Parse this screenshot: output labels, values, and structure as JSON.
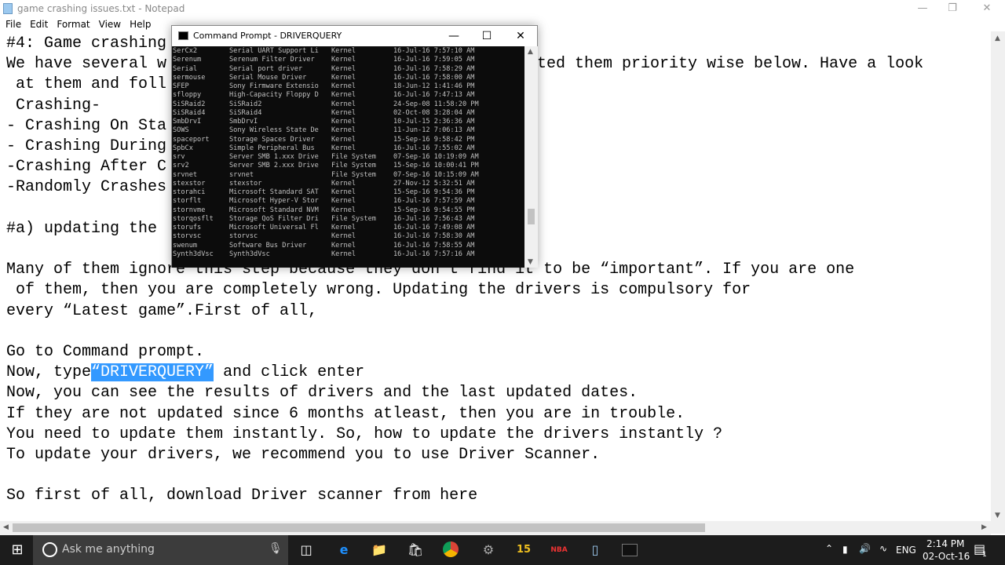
{
  "notepad": {
    "title": "game crashing issues.txt - Notepad",
    "menu": [
      "File",
      "Edit",
      "Format",
      "View",
      "Help"
    ],
    "lines": [
      {
        "left": "#4: Game crashing",
        "right": ""
      },
      {
        "left": "We have several w",
        "right": "ted them priority wise below. Have a look"
      },
      {
        "left": " at them and foll",
        "right": ""
      },
      {
        "left": " Crashing-",
        "right": ""
      },
      {
        "left": "- Crashing On Sta",
        "right": ""
      },
      {
        "left": "- Crashing During",
        "right": ""
      },
      {
        "left": "-Crashing After C",
        "right": ""
      },
      {
        "left": "-Randomly Crashes",
        "right": ""
      },
      {
        "left": "",
        "right": ""
      },
      {
        "left": "#a) updating the ",
        "right": ""
      },
      {
        "left": "",
        "right": ""
      },
      {
        "left": "Many of them ignore this step because they don’t find it to be “important”. If you are one",
        "right": ""
      },
      {
        "left": " of them, then you are completely wrong. Updating the drivers is compulsory for",
        "right": ""
      },
      {
        "left": "every “Latest game”.First of all,",
        "right": ""
      },
      {
        "left": "",
        "right": ""
      },
      {
        "left": "Go to Command prompt.",
        "right": ""
      },
      {
        "left": "Now, type",
        "right": ""
      },
      {
        "left": "Now, you can see the results of drivers and the last updated dates.",
        "right": ""
      },
      {
        "left": "If they are not updated since 6 months atleast, then you are in trouble.",
        "right": ""
      },
      {
        "left": "You need to update them instantly. So, how to update the drivers instantly ?",
        "right": ""
      },
      {
        "left": "To update your drivers, we recommend you to use Driver Scanner.",
        "right": ""
      },
      {
        "left": "",
        "right": ""
      },
      {
        "left": "So first of all, download Driver scanner from here",
        "right": ""
      }
    ],
    "selected_text": "“DRIVERQUERY”",
    "after_selection": " and click enter",
    "selection_color": "#3399ff"
  },
  "cmd": {
    "title": "Command Prompt - DRIVERQUERY",
    "rows": [
      [
        "SerCx2",
        "Serial UART Support Li",
        "Kernel",
        "16-Jul-16 7:57:10 AM"
      ],
      [
        "Serenum",
        "Serenum Filter Driver",
        "Kernel",
        "16-Jul-16 7:59:05 AM"
      ],
      [
        "Serial",
        "Serial port driver",
        "Kernel",
        "16-Jul-16 7:58:29 AM"
      ],
      [
        "sermouse",
        "Serial Mouse Driver",
        "Kernel",
        "16-Jul-16 7:58:00 AM"
      ],
      [
        "SFEP",
        "Sony Firmware Extensio",
        "Kernel",
        "18-Jun-12 1:41:46 PM"
      ],
      [
        "sfloppy",
        "High-Capacity Floppy D",
        "Kernel",
        "16-Jul-16 7:47:13 AM"
      ],
      [
        "SiSRaid2",
        "SiSRaid2",
        "Kernel",
        "24-Sep-08 11:58:20 PM"
      ],
      [
        "SiSRaid4",
        "SiSRaid4",
        "Kernel",
        "02-Oct-08 3:28:04 AM"
      ],
      [
        "SmbDrvI",
        "SmbDrvI",
        "Kernel",
        "10-Jul-15 2:36:36 AM"
      ],
      [
        "SOWS",
        "Sony Wireless State De",
        "Kernel",
        "11-Jun-12 7:06:13 AM"
      ],
      [
        "spaceport",
        "Storage Spaces Driver",
        "Kernel",
        "15-Sep-16 9:58:42 PM"
      ],
      [
        "SpbCx",
        "Simple Peripheral Bus",
        "Kernel",
        "16-Jul-16 7:55:02 AM"
      ],
      [
        "srv",
        "Server SMB 1.xxx Drive",
        "File System",
        "07-Sep-16 10:19:09 AM"
      ],
      [
        "srv2",
        "Server SMB 2.xxx Drive",
        "File System",
        "15-Sep-16 10:00:41 PM"
      ],
      [
        "srvnet",
        "srvnet",
        "File System",
        "07-Sep-16 10:15:09 AM"
      ],
      [
        "stexstor",
        "stexstor",
        "Kernel",
        "27-Nov-12 5:32:51 AM"
      ],
      [
        "storahci",
        "Microsoft Standard SAT",
        "Kernel",
        "15-Sep-16 9:54:36 PM"
      ],
      [
        "storflt",
        "Microsoft Hyper-V Stor",
        "Kernel",
        "16-Jul-16 7:57:59 AM"
      ],
      [
        "stornvme",
        "Microsoft Standard NVM",
        "Kernel",
        "15-Sep-16 9:54:55 PM"
      ],
      [
        "storqosflt",
        "Storage QoS Filter Dri",
        "File System",
        "16-Jul-16 7:56:43 AM"
      ],
      [
        "storufs",
        "Microsoft Universal Fl",
        "Kernel",
        "16-Jul-16 7:49:08 AM"
      ],
      [
        "storvsc",
        "storvsc",
        "Kernel",
        "16-Jul-16 7:58:30 AM"
      ],
      [
        "swenum",
        "Software Bus Driver",
        "Kernel",
        "16-Jul-16 7:58:55 AM"
      ],
      [
        "Synth3dVsc",
        "Synth3dVsc",
        "Kernel",
        "16-Jul-16 7:57:16 AM"
      ]
    ]
  },
  "taskbar": {
    "search_placeholder": "Ask me anything",
    "time": "2:14 PM",
    "date": "02-Oct-16",
    "language": "ENG",
    "notification_count": "1",
    "apps": [
      "task-view",
      "edge",
      "file-explorer",
      "store",
      "chrome",
      "app",
      "pes-15",
      "nba-2k17",
      "notepad",
      "command-prompt"
    ]
  }
}
